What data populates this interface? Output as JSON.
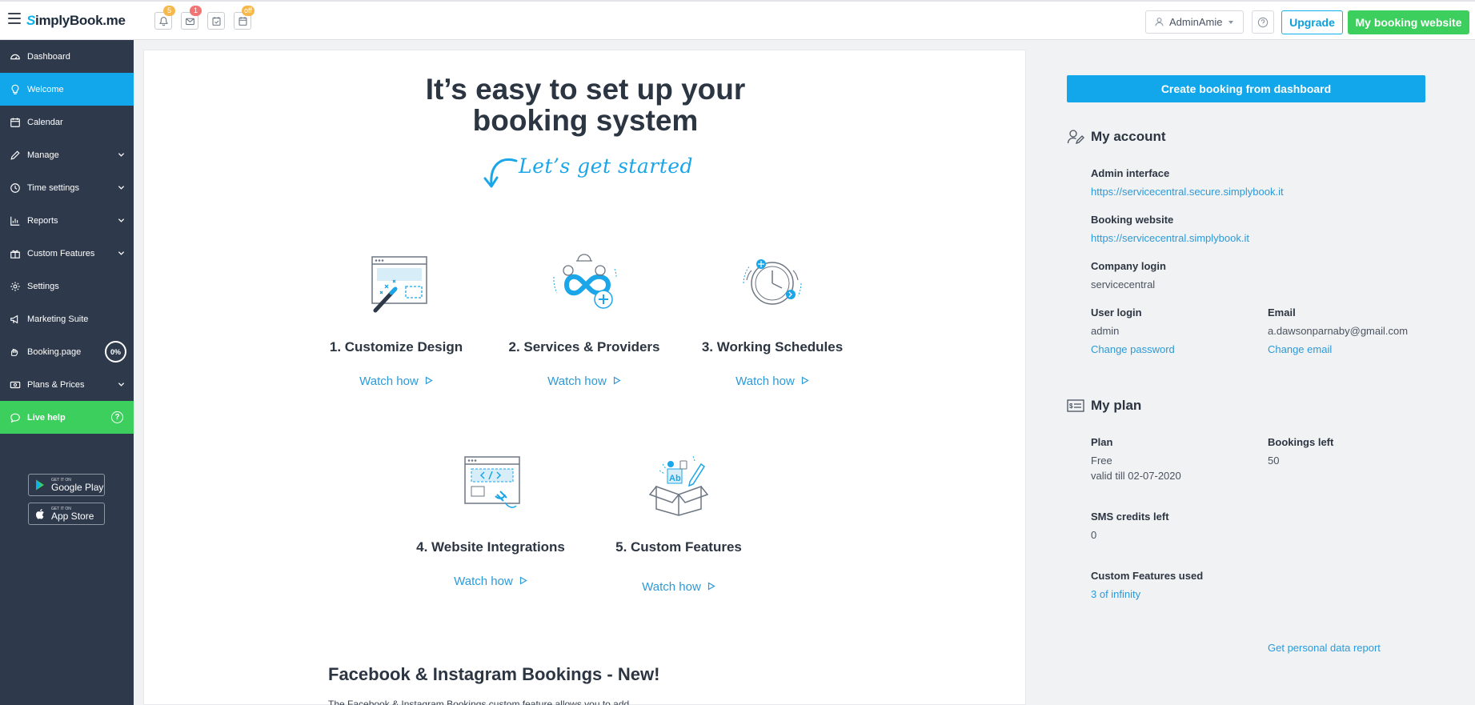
{
  "brand": {
    "logo_s": "S",
    "logo_rest": "implyBook",
    "logo_me": ".me"
  },
  "topbar": {
    "badges": {
      "notifications": "5",
      "messages": "1",
      "calendar_status": "off"
    },
    "user_name": "AdminAmie",
    "upgrade_label": "Upgrade",
    "my_booking_website_label": "My booking website"
  },
  "sidebar": {
    "items": [
      {
        "label": "Dashboard"
      },
      {
        "label": "Welcome"
      },
      {
        "label": "Calendar"
      },
      {
        "label": "Manage"
      },
      {
        "label": "Time settings"
      },
      {
        "label": "Reports"
      },
      {
        "label": "Custom Features"
      },
      {
        "label": "Settings"
      },
      {
        "label": "Marketing Suite"
      },
      {
        "label": "Booking.page",
        "progress": "0%"
      },
      {
        "label": "Plans & Prices"
      },
      {
        "label": "Live help"
      }
    ],
    "stores": {
      "google_small": "GET IT ON",
      "google_big": "Google Play",
      "apple_small": "GET IT ON",
      "apple_big": "App Store"
    }
  },
  "main": {
    "hero_line1": "It’s easy to set up your",
    "hero_line2": "booking system",
    "lets_get_started": "Let’s get started",
    "features": [
      {
        "title": "1. Customize Design",
        "watch": "Watch how"
      },
      {
        "title": "2. Services & Providers",
        "watch": "Watch how"
      },
      {
        "title": "3. Working Schedules",
        "watch": "Watch how"
      },
      {
        "title": "4. Website Integrations",
        "watch": "Watch how"
      },
      {
        "title": "5. Custom Features",
        "watch": "Watch how"
      }
    ],
    "fb_title": "Facebook & Instagram Bookings - New!",
    "fb_text": "The Facebook & Instagram Bookings custom feature allows you to add"
  },
  "right": {
    "create_booking_label": "Create booking from dashboard",
    "account": {
      "heading": "My account",
      "admin_interface_label": "Admin interface",
      "admin_interface_url": "https://servicecentral.secure.simplybook.it",
      "booking_website_label": "Booking website",
      "booking_website_url": "https://servicecentral.simplybook.it",
      "company_login_label": "Company login",
      "company_login": "servicecentral",
      "user_login_label": "User login",
      "user_login": "admin",
      "change_password": "Change password",
      "email_label": "Email",
      "email": "a.dawsonparnaby@gmail.com",
      "change_email": "Change email"
    },
    "plan": {
      "heading": "My plan",
      "plan_label": "Plan",
      "plan_value": "Free",
      "valid_till": "valid till 02-07-2020",
      "bookings_left_label": "Bookings left",
      "bookings_left": "50",
      "sms_label": "SMS credits left",
      "sms_value": "0",
      "custom_features_label": "Custom Features used",
      "custom_features_value": "3 of infinity",
      "personal_data_report": "Get personal data report"
    }
  }
}
